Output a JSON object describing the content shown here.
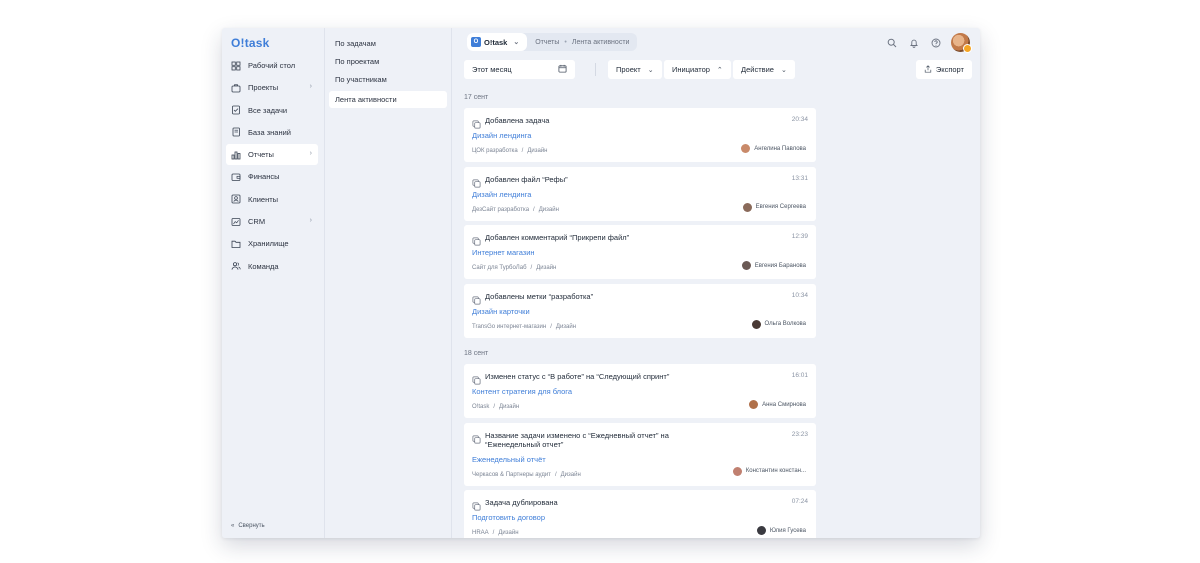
{
  "app": {
    "logo": "O!task",
    "sidebar": {
      "items": [
        {
          "label": "Рабочий стол",
          "icon": "dashboard-icon",
          "active": false,
          "chevron": false
        },
        {
          "label": "Проекты",
          "icon": "briefcase-icon",
          "active": false,
          "chevron": true
        },
        {
          "label": "Все задачи",
          "icon": "tasks-icon",
          "active": false,
          "chevron": false
        },
        {
          "label": "База знаний",
          "icon": "book-icon",
          "active": false,
          "chevron": false
        },
        {
          "label": "Отчеты",
          "icon": "chart-icon",
          "active": true,
          "chevron": true
        },
        {
          "label": "Финансы",
          "icon": "wallet-icon",
          "active": false,
          "chevron": false
        },
        {
          "label": "Клиенты",
          "icon": "contacts-icon",
          "active": false,
          "chevron": false
        },
        {
          "label": "CRM",
          "icon": "crm-icon",
          "active": false,
          "chevron": true
        },
        {
          "label": "Хранилище",
          "icon": "folder-icon",
          "active": false,
          "chevron": false
        },
        {
          "label": "Команда",
          "icon": "team-icon",
          "active": false,
          "chevron": false
        }
      ],
      "collapse_label": "Свернуть"
    },
    "subnav": {
      "items": [
        {
          "label": "По задачам",
          "active": false
        },
        {
          "label": "По проектам",
          "active": false
        },
        {
          "label": "По участникам",
          "active": false
        },
        {
          "label": "Лента активности",
          "active": true
        }
      ]
    },
    "topbar": {
      "workspace": "O!task",
      "workspace_badge": "O",
      "breadcrumb": [
        "Отчеты",
        "Лента активности"
      ]
    },
    "filters": {
      "period": "Этот месяц",
      "project": "Проект",
      "initiator": "Инициатор",
      "action": "Действие",
      "export": "Экспорт"
    },
    "feed": [
      {
        "date": "17 сент",
        "events": [
          {
            "title": "Добавлена задача",
            "time": "20:34",
            "task": "Дизайн лендинга",
            "project": "ЦОК разработка",
            "section": "Дизайн",
            "user": "Ангелина Павлова",
            "avatar_color": "#c98a6a",
            "tall": false
          },
          {
            "title": "Добавлен файл “Рефы”",
            "time": "13:31",
            "task": "Дизайн лендинга",
            "project": "ДезСайт разработка",
            "section": "Дизайн",
            "user": "Евгения Сергеева",
            "avatar_color": "#8a6a5a",
            "tall": false
          },
          {
            "title": "Добавлен комментарий “Прикрепи файл”",
            "time": "12:39",
            "task": "Интернет магазин",
            "project": "Сайт для ТурбоЛаб",
            "section": "Дизайн",
            "user": "Евгения Баранова",
            "avatar_color": "#6b5a55",
            "tall": false
          },
          {
            "title": "Добавлены метки “разработка”",
            "time": "10:34",
            "task": "Дизайн карточки",
            "project": "TransGo интернет-магазин",
            "section": "Дизайн",
            "user": "Ольга Волкова",
            "avatar_color": "#4a3a35",
            "tall": false
          }
        ]
      },
      {
        "date": "18 сент",
        "events": [
          {
            "title": "Изменен статус с “В работе” на “Следующий спринт”",
            "time": "16:01",
            "task": "Контент стратегия для блога",
            "project": "O!task",
            "section": "Дизайн",
            "user": "Анна Смирнова",
            "avatar_color": "#b0704a",
            "tall": false
          },
          {
            "title": "Название задачи изменено с “Ежедневный отчет” на\n“Еженедельный отчет”",
            "time": "23:23",
            "task": "Еженедельный отчёт",
            "project": "Черкасов & Партнеры аудит",
            "section": "Дизайн",
            "user": "Константин констан...",
            "avatar_color": "#c08070",
            "tall": true
          },
          {
            "title": "Задача дублирована",
            "time": "07:24",
            "task": "Подготовить договор",
            "project": "HRAA",
            "section": "Дизайн",
            "user": "Юлия Гусева",
            "avatar_color": "#3a3a40",
            "tall": false
          }
        ]
      }
    ]
  }
}
